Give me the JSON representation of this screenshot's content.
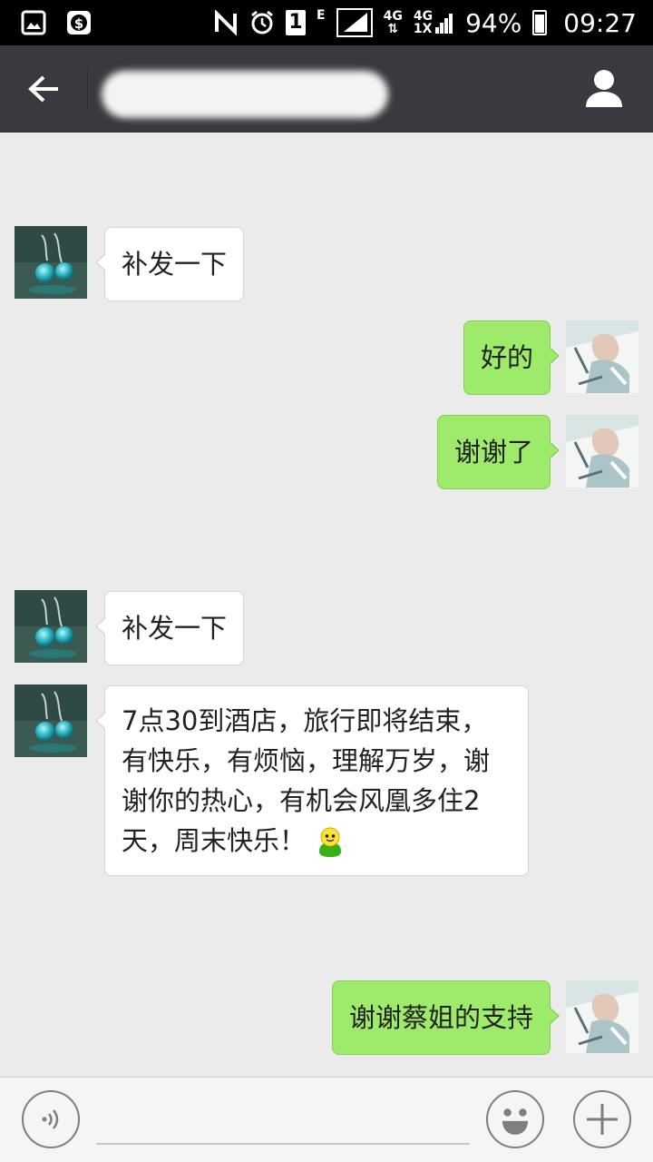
{
  "status_bar": {
    "network_4g_top": "4G",
    "network_4g_1x": "4G",
    "network_1x": "1X",
    "e_label": "E",
    "sim_label": "1",
    "battery": "94%",
    "time": "09:27"
  },
  "header": {
    "contact_name": ""
  },
  "messages": [
    {
      "side": "in",
      "text": "补发一下"
    },
    {
      "side": "out",
      "text": "好的"
    },
    {
      "side": "out",
      "text": "谢谢了"
    },
    {
      "side": "in",
      "text": "补发一下"
    },
    {
      "side": "in",
      "lines": [
        "7点30到酒店，旅行即将结束，",
        "有快乐，有烦恼，理解万岁，谢",
        "谢你的热心，有机会风凰多住2",
        "天，周末快乐！"
      ]
    },
    {
      "side": "out",
      "text": "谢谢蔡姐的支持"
    }
  ],
  "input": {
    "placeholder": "",
    "value": ""
  },
  "icons": {
    "back": "back-arrow-icon",
    "profile": "person-icon",
    "voice": "voice-icon",
    "emoji": "emoji-icon",
    "more": "plus-icon"
  },
  "colors": {
    "title_bar": "#393a3f",
    "chat_background": "#ebebeb",
    "outgoing_bubble": "#9eea6a",
    "incoming_bubble": "#ffffff"
  }
}
